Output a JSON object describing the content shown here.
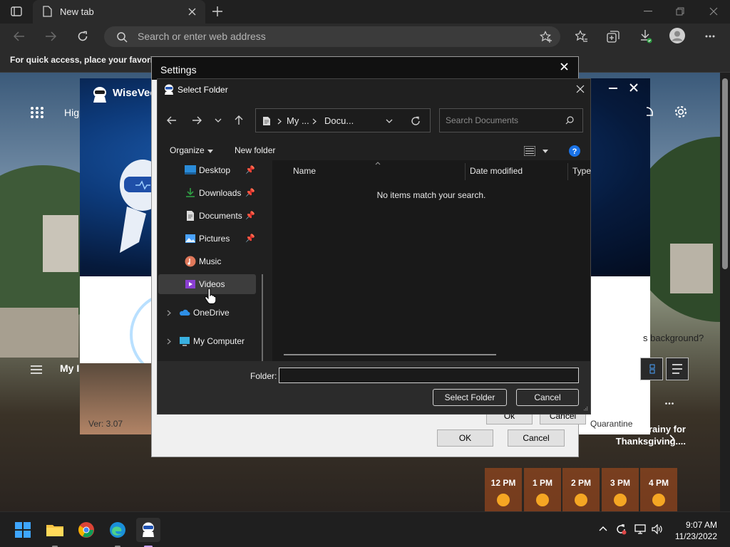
{
  "browser": {
    "tab_title": "New tab",
    "address_placeholder": "Search or enter web address",
    "favorites_bar_text": "For quick access, place your favorites"
  },
  "wisevector": {
    "title": "WiseVec",
    "nav_label": "Hig",
    "version": "Ver: 3.07",
    "quarantine": "Quarantine",
    "my_label": "My I",
    "bg_question": "s background?"
  },
  "settings": {
    "title": "Settings",
    "ok_label": "OK",
    "cancel_label": "Cancel",
    "inner_ok_label": "Ok",
    "inner_cancel_label": "Cancel"
  },
  "select_folder": {
    "title": "Select Folder",
    "breadcrumb": [
      "My ...",
      "Docu..."
    ],
    "search_placeholder": "Search Documents",
    "organize_label": "Organize",
    "new_folder_label": "New folder",
    "nav_items": [
      {
        "label": "Desktop",
        "icon": "desktop-icon",
        "pinned": true
      },
      {
        "label": "Downloads",
        "icon": "downloads-icon",
        "pinned": true
      },
      {
        "label": "Documents",
        "icon": "documents-icon",
        "pinned": true
      },
      {
        "label": "Pictures",
        "icon": "pictures-icon",
        "pinned": true
      },
      {
        "label": "Music",
        "icon": "music-icon",
        "pinned": false
      },
      {
        "label": "Videos",
        "icon": "videos-icon",
        "pinned": false,
        "selected": true
      }
    ],
    "tree_items": [
      {
        "label": "OneDrive",
        "icon": "onedrive-icon"
      },
      {
        "label": "My Computer",
        "icon": "computer-icon"
      }
    ],
    "columns": [
      "Name",
      "Date modified",
      "Type"
    ],
    "empty_message": "No items match your search.",
    "folder_label": "Folder:",
    "folder_value": "",
    "select_button": "Select Folder",
    "cancel_button": "Cancel"
  },
  "weather": {
    "promo": "king rainy for Thanksgiving....",
    "hours": [
      "12 PM",
      "1 PM",
      "2 PM",
      "3 PM",
      "4 PM"
    ]
  },
  "taskbar": {
    "time": "9:07 AM",
    "date": "11/23/2022"
  },
  "colors": {
    "accent_blue": "#1a73e8",
    "dialog_bg": "#202020",
    "selected_row": "#3d3d3d"
  }
}
